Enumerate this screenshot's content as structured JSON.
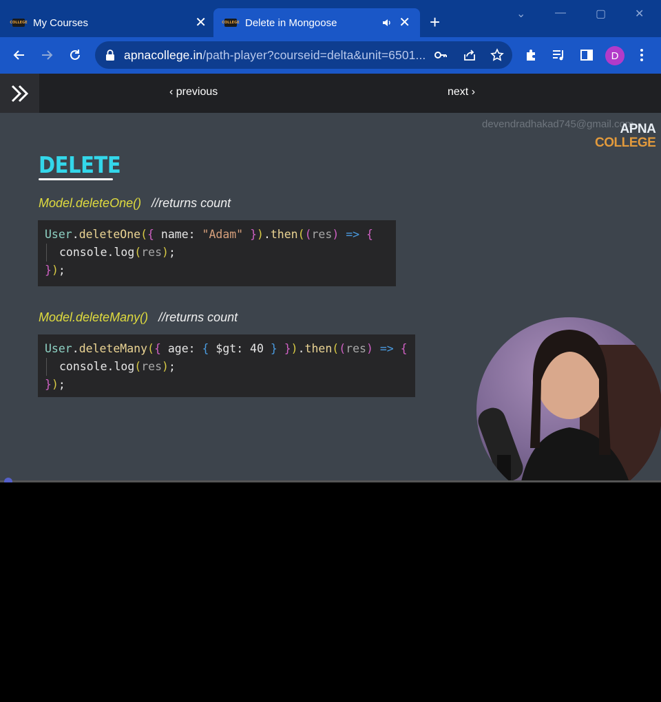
{
  "browser": {
    "tabs": [
      {
        "label": "My Courses",
        "favicon": "apna-college-favicon",
        "active": false
      },
      {
        "label": "Delete in Mongoose",
        "favicon": "apna-college-favicon",
        "active": true,
        "audio": true
      }
    ],
    "favicon_text": "COLLEGE",
    "url_domain": "apnacollege.in",
    "url_rest": "/path-player?courseid=delta&unit=6501...",
    "profile_initial": "D",
    "colors": {
      "frame": "#0b3d91",
      "toolbar": "#1a57c7",
      "avatar": "#b23bc9"
    }
  },
  "page_nav": {
    "previous_label": "‹ previous",
    "next_label": "next ›"
  },
  "video": {
    "watermark_email": "devendradhakad745@gmail.com",
    "logo_line1": "APNA",
    "logo_line2": "COLLEGE",
    "slide_title": "DELETE",
    "method1": {
      "name": "Model.deleteOne()",
      "comment": "//returns count"
    },
    "method2": {
      "name": "Model.deleteMany()",
      "comment": "//returns count"
    },
    "code1": [
      [
        [
          "User",
          "c-obj"
        ],
        [
          ".",
          ""
        ],
        [
          "deleteOne",
          "c-fn"
        ],
        [
          "(",
          "c-br1"
        ],
        [
          "{",
          "c-br2"
        ],
        [
          " name: ",
          ""
        ],
        [
          "\"Adam\"",
          "c-str"
        ],
        [
          " ",
          ""
        ],
        [
          "}",
          "c-br2"
        ],
        [
          ")",
          "c-br1"
        ],
        [
          ".",
          ""
        ],
        [
          "then",
          "c-fn"
        ],
        [
          "(",
          "c-br1"
        ],
        [
          "(",
          "c-br2"
        ],
        [
          "res",
          "c-par"
        ],
        [
          ")",
          "c-br2"
        ],
        [
          " ",
          ""
        ],
        [
          "=>",
          "c-arrow"
        ],
        [
          " ",
          ""
        ],
        [
          "{",
          "c-br2"
        ]
      ],
      [
        [
          "console",
          ""
        ],
        [
          ".",
          ""
        ],
        [
          "log",
          ""
        ],
        [
          "(",
          "c-br1"
        ],
        [
          "res",
          "c-par"
        ],
        [
          ")",
          "c-br1"
        ],
        [
          ";",
          ""
        ]
      ],
      [
        [
          "}",
          "c-br2"
        ],
        [
          ")",
          "c-br1"
        ],
        [
          ";",
          ""
        ]
      ]
    ],
    "code2": [
      [
        [
          "User",
          "c-obj"
        ],
        [
          ".",
          ""
        ],
        [
          "deleteMany",
          "c-fn"
        ],
        [
          "(",
          "c-br1"
        ],
        [
          "{",
          "c-br2"
        ],
        [
          " age: ",
          ""
        ],
        [
          "{",
          "c-br3"
        ],
        [
          " $gt: 40 ",
          ""
        ],
        [
          "}",
          "c-br3"
        ],
        [
          " ",
          ""
        ],
        [
          "}",
          "c-br2"
        ],
        [
          ")",
          "c-br1"
        ],
        [
          ".",
          ""
        ],
        [
          "then",
          "c-fn"
        ],
        [
          "(",
          "c-br1"
        ],
        [
          "(",
          "c-br2"
        ],
        [
          "res",
          "c-par"
        ],
        [
          ")",
          "c-br2"
        ],
        [
          " ",
          ""
        ],
        [
          "=>",
          "c-arrow"
        ],
        [
          " ",
          ""
        ],
        [
          "{",
          "c-br2"
        ]
      ],
      [
        [
          "console",
          ""
        ],
        [
          ".",
          ""
        ],
        [
          "log",
          ""
        ],
        [
          "(",
          "c-br1"
        ],
        [
          "res",
          "c-par"
        ],
        [
          ")",
          "c-br1"
        ],
        [
          ";",
          ""
        ]
      ],
      [
        [
          "}",
          "c-br2"
        ],
        [
          ")",
          "c-br1"
        ],
        [
          ";",
          ""
        ]
      ]
    ],
    "progress_fraction": 0.01
  }
}
